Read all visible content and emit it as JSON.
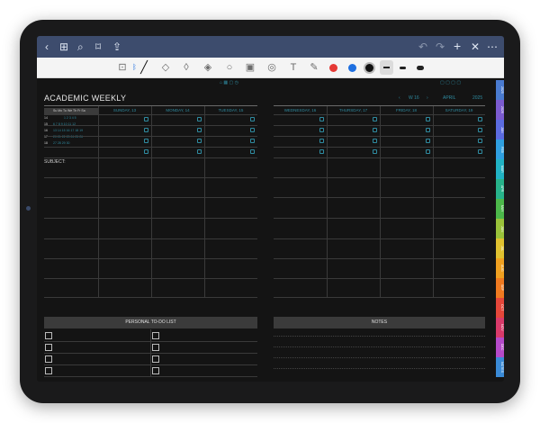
{
  "nav": {
    "back": "‹",
    "grid": "⊞",
    "search": "⌕",
    "bookmark": "⌑",
    "share": "⇪",
    "undo": "↶",
    "redo": "↷",
    "add": "+",
    "close": "✕",
    "more": "⋯"
  },
  "toolbar": {
    "colors": [
      "#e53935",
      "#1e6fe0",
      "#111111"
    ],
    "accent": "#2f8ba0"
  },
  "planner": {
    "title": "ACADEMIC WEEKLY",
    "week_prev": "‹",
    "week_label": "W 16",
    "week_next": "›",
    "month": "APRIL",
    "year": "2025",
    "mini_cal_header": "Su Mo Tu We Th Fr Sa",
    "mini_cal_rows": [
      {
        "wk": "14",
        "days": "1  2  3  4  5"
      },
      {
        "wk": "15",
        "days": "6  7  8  9 10 11 12"
      },
      {
        "wk": "16",
        "days": "13 14 15 16 17 18 19"
      },
      {
        "wk": "17",
        "days": "20 21 22 23 24 25 26"
      },
      {
        "wk": "18",
        "days": "27 28 29 30"
      }
    ],
    "subject_label": "SUBJECT:",
    "days_left": [
      "SUNDAY, 13",
      "MONDAY, 14",
      "TUESDAY, 15"
    ],
    "days_right": [
      "WEDNESDAY, 16",
      "THURSDAY, 17",
      "FRIDAY, 18",
      "SATURDAY, 19"
    ],
    "todo_header": "PERSONAL TO-DO LIST",
    "notes_header": "NOTES"
  },
  "side_tabs": [
    {
      "label": "2025",
      "color": "#4a7bd0"
    },
    {
      "label": "2026",
      "color": "#7b5bd0"
    },
    {
      "label": "JAN",
      "color": "#5b6be0"
    },
    {
      "label": "FEB",
      "color": "#2f9fe0"
    },
    {
      "label": "MAR",
      "color": "#21b3c4"
    },
    {
      "label": "APR",
      "color": "#27b38a"
    },
    {
      "label": "MAY",
      "color": "#4cb84a"
    },
    {
      "label": "JUN",
      "color": "#9ac23a"
    },
    {
      "label": "JUL",
      "color": "#e0c12f"
    },
    {
      "label": "AUG",
      "color": "#f0a020"
    },
    {
      "label": "SEP",
      "color": "#f07a20"
    },
    {
      "label": "OCT",
      "color": "#e5473a"
    },
    {
      "label": "NOV",
      "color": "#d93a6a"
    },
    {
      "label": "DEC",
      "color": "#b54ac9"
    },
    {
      "label": "NOTES",
      "color": "#3a8ad6"
    }
  ]
}
